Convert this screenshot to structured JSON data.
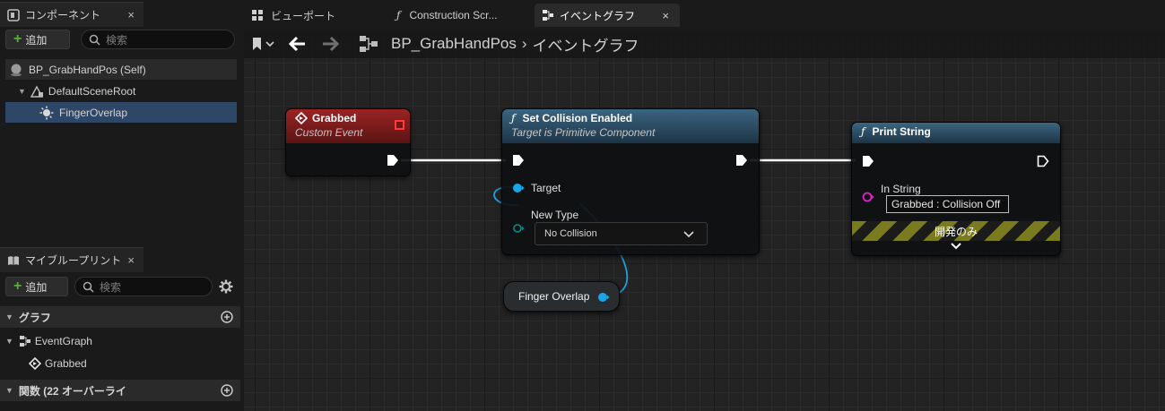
{
  "components_panel": {
    "tab_label": "コンポーネント",
    "close_glyph": "×",
    "add_label": "追加",
    "search_placeholder": "検索",
    "tree": [
      {
        "label": "BP_GrabHandPos (Self)",
        "icon": "actor-sphere-icon"
      },
      {
        "label": "DefaultSceneRoot",
        "icon": "scene-root-icon"
      },
      {
        "label": "FingerOverlap",
        "icon": "sphere-collision-icon"
      }
    ]
  },
  "my_blueprint_panel": {
    "tab_label": "マイブループリント",
    "close_glyph": "×",
    "add_label": "追加",
    "search_placeholder": "検索",
    "sections": {
      "graphs": "グラフ",
      "functions": "関数 (22 オーバーライ"
    },
    "items": {
      "event_graph": "EventGraph",
      "grabbed_event": "Grabbed"
    }
  },
  "document_tabs": [
    {
      "label": "ビューポート",
      "icon": "viewport-grid-icon"
    },
    {
      "label": "Construction Scr...",
      "icon": "function-icon"
    },
    {
      "label": "イベントグラフ",
      "icon": "event-graph-icon",
      "close_glyph": "×",
      "active": true
    }
  ],
  "graph_toolbar": {
    "breadcrumb_blueprint": "BP_GrabHandPos",
    "breadcrumb_separator": "›",
    "breadcrumb_graph": "イベントグラフ"
  },
  "nodes": {
    "grabbed": {
      "title": "Grabbed",
      "subtitle": "Custom Event",
      "header_color": "#7c1c1c"
    },
    "set_collision": {
      "title": "Set Collision Enabled",
      "subtitle": "Target is Primitive Component",
      "header_color": "#2d4f66",
      "target_label": "Target",
      "new_type_label": "New Type",
      "new_type_value": "No Collision"
    },
    "print_string": {
      "title": "Print String",
      "header_color": "#2d4f66",
      "in_string_label": "In String",
      "in_string_value": "Grabbed : Collision Off",
      "development_only_label": "開発のみ"
    },
    "finger_overlap": {
      "label": "Finger Overlap"
    }
  },
  "colors": {
    "exec_wire": "#ffffff",
    "object_pin": "#19a6e8",
    "string_pin": "#e020c8",
    "enum_pin": "#0b6e6a",
    "add_plus": "#58b03a",
    "selected_row": "#2f4766"
  }
}
